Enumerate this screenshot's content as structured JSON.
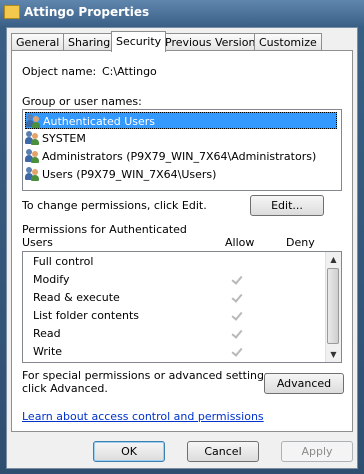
{
  "window": {
    "title": "Attingo Properties"
  },
  "tabs": [
    {
      "label": "General"
    },
    {
      "label": "Sharing"
    },
    {
      "label": "Security"
    },
    {
      "label": "Previous Versions"
    },
    {
      "label": "Customize"
    }
  ],
  "security": {
    "object_name_label": "Object name:",
    "object_name_value": "C:\\Attingo",
    "group_label": "Group or user names:",
    "users": [
      {
        "name": "Authenticated Users",
        "icon": "users-group-icon",
        "selected": true
      },
      {
        "name": "SYSTEM",
        "icon": "users-group-icon",
        "selected": false
      },
      {
        "name": "Administrators (P9X79_WIN_7X64\\Administrators)",
        "icon": "users-group-icon",
        "selected": false
      },
      {
        "name": "Users (P9X79_WIN_7X64\\Users)",
        "icon": "users-group-icon",
        "selected": false
      }
    ],
    "change_text": "To change permissions, click Edit.",
    "edit_button": "Edit...",
    "permissions_label_line1": "Permissions for Authenticated",
    "permissions_label_line2": "Users",
    "allow_header": "Allow",
    "deny_header": "Deny",
    "permissions": [
      {
        "name": "Full control",
        "allow": false,
        "deny": false
      },
      {
        "name": "Modify",
        "allow": true,
        "deny": false
      },
      {
        "name": "Read & execute",
        "allow": true,
        "deny": false
      },
      {
        "name": "List folder contents",
        "allow": true,
        "deny": false
      },
      {
        "name": "Read",
        "allow": true,
        "deny": false
      },
      {
        "name": "Write",
        "allow": true,
        "deny": false
      }
    ],
    "special_line1": "For special permissions or advanced settings,",
    "special_line2": "click Advanced.",
    "advanced_button": "Advanced",
    "learn_link": "Learn about access control and permissions"
  },
  "footer": {
    "ok": "OK",
    "cancel": "Cancel",
    "apply": "Apply"
  }
}
